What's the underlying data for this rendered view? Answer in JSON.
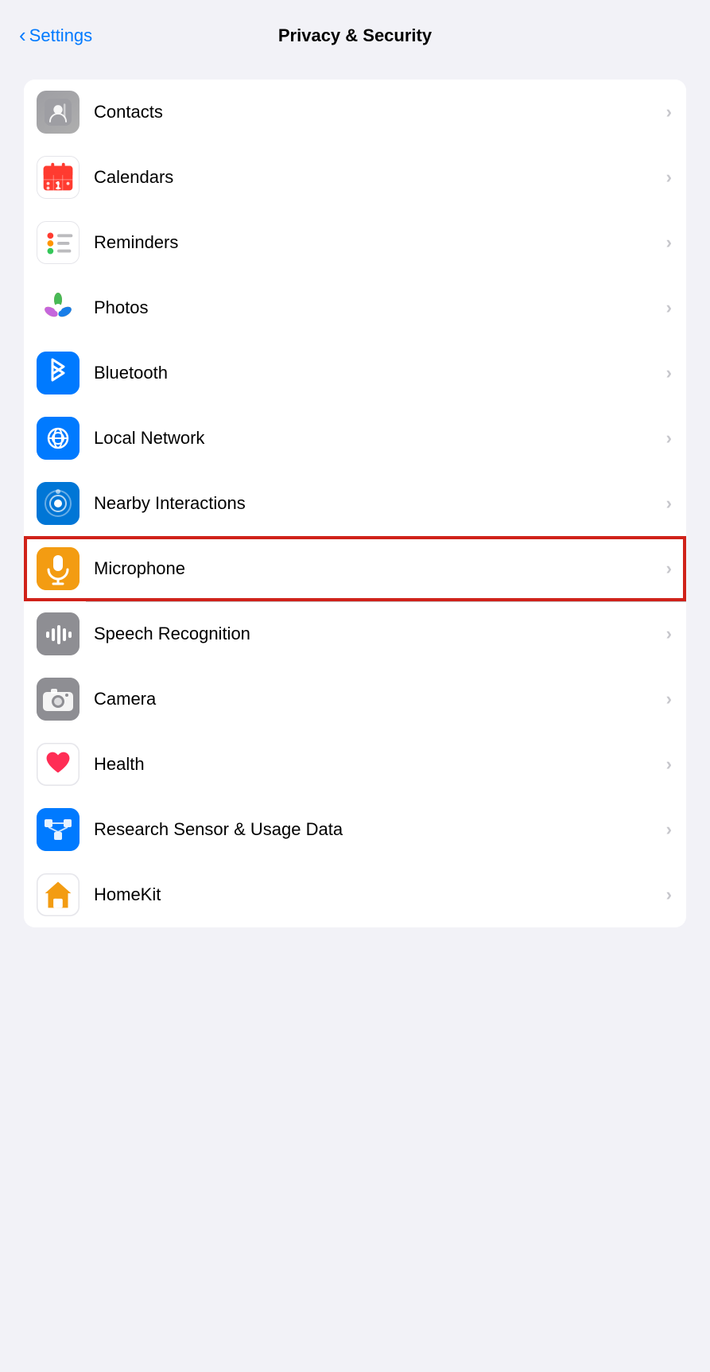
{
  "header": {
    "back_label": "Settings",
    "title": "Privacy & Security"
  },
  "list_items": [
    {
      "id": "contacts",
      "label": "Contacts",
      "icon_bg": "#9e9ea3",
      "icon_type": "contacts",
      "highlighted": false
    },
    {
      "id": "calendars",
      "label": "Calendars",
      "icon_bg": "#ffffff",
      "icon_type": "calendars",
      "highlighted": false
    },
    {
      "id": "reminders",
      "label": "Reminders",
      "icon_bg": "#ffffff",
      "icon_type": "reminders",
      "highlighted": false
    },
    {
      "id": "photos",
      "label": "Photos",
      "icon_bg": "#ffffff",
      "icon_type": "photos",
      "highlighted": false
    },
    {
      "id": "bluetooth",
      "label": "Bluetooth",
      "icon_bg": "#007aff",
      "icon_type": "bluetooth",
      "highlighted": false
    },
    {
      "id": "local-network",
      "label": "Local Network",
      "icon_bg": "#007aff",
      "icon_type": "localnetwork",
      "highlighted": false
    },
    {
      "id": "nearby-interactions",
      "label": "Nearby Interactions",
      "icon_bg": "#0076d6",
      "icon_type": "nearby",
      "highlighted": false
    },
    {
      "id": "microphone",
      "label": "Microphone",
      "icon_bg": "#f39c12",
      "icon_type": "microphone",
      "highlighted": true
    },
    {
      "id": "speech-recognition",
      "label": "Speech Recognition",
      "icon_bg": "#8e8e93",
      "icon_type": "speech",
      "highlighted": false
    },
    {
      "id": "camera",
      "label": "Camera",
      "icon_bg": "#8e8e93",
      "icon_type": "camera",
      "highlighted": false
    },
    {
      "id": "health",
      "label": "Health",
      "icon_bg": "#ffffff",
      "icon_type": "health",
      "highlighted": false
    },
    {
      "id": "research-sensor",
      "label": "Research Sensor & Usage Data",
      "icon_bg": "#007aff",
      "icon_type": "research",
      "highlighted": false
    },
    {
      "id": "homekit",
      "label": "HomeKit",
      "icon_bg": "#ffffff",
      "icon_type": "homekit",
      "highlighted": false
    }
  ],
  "chevron": "›"
}
